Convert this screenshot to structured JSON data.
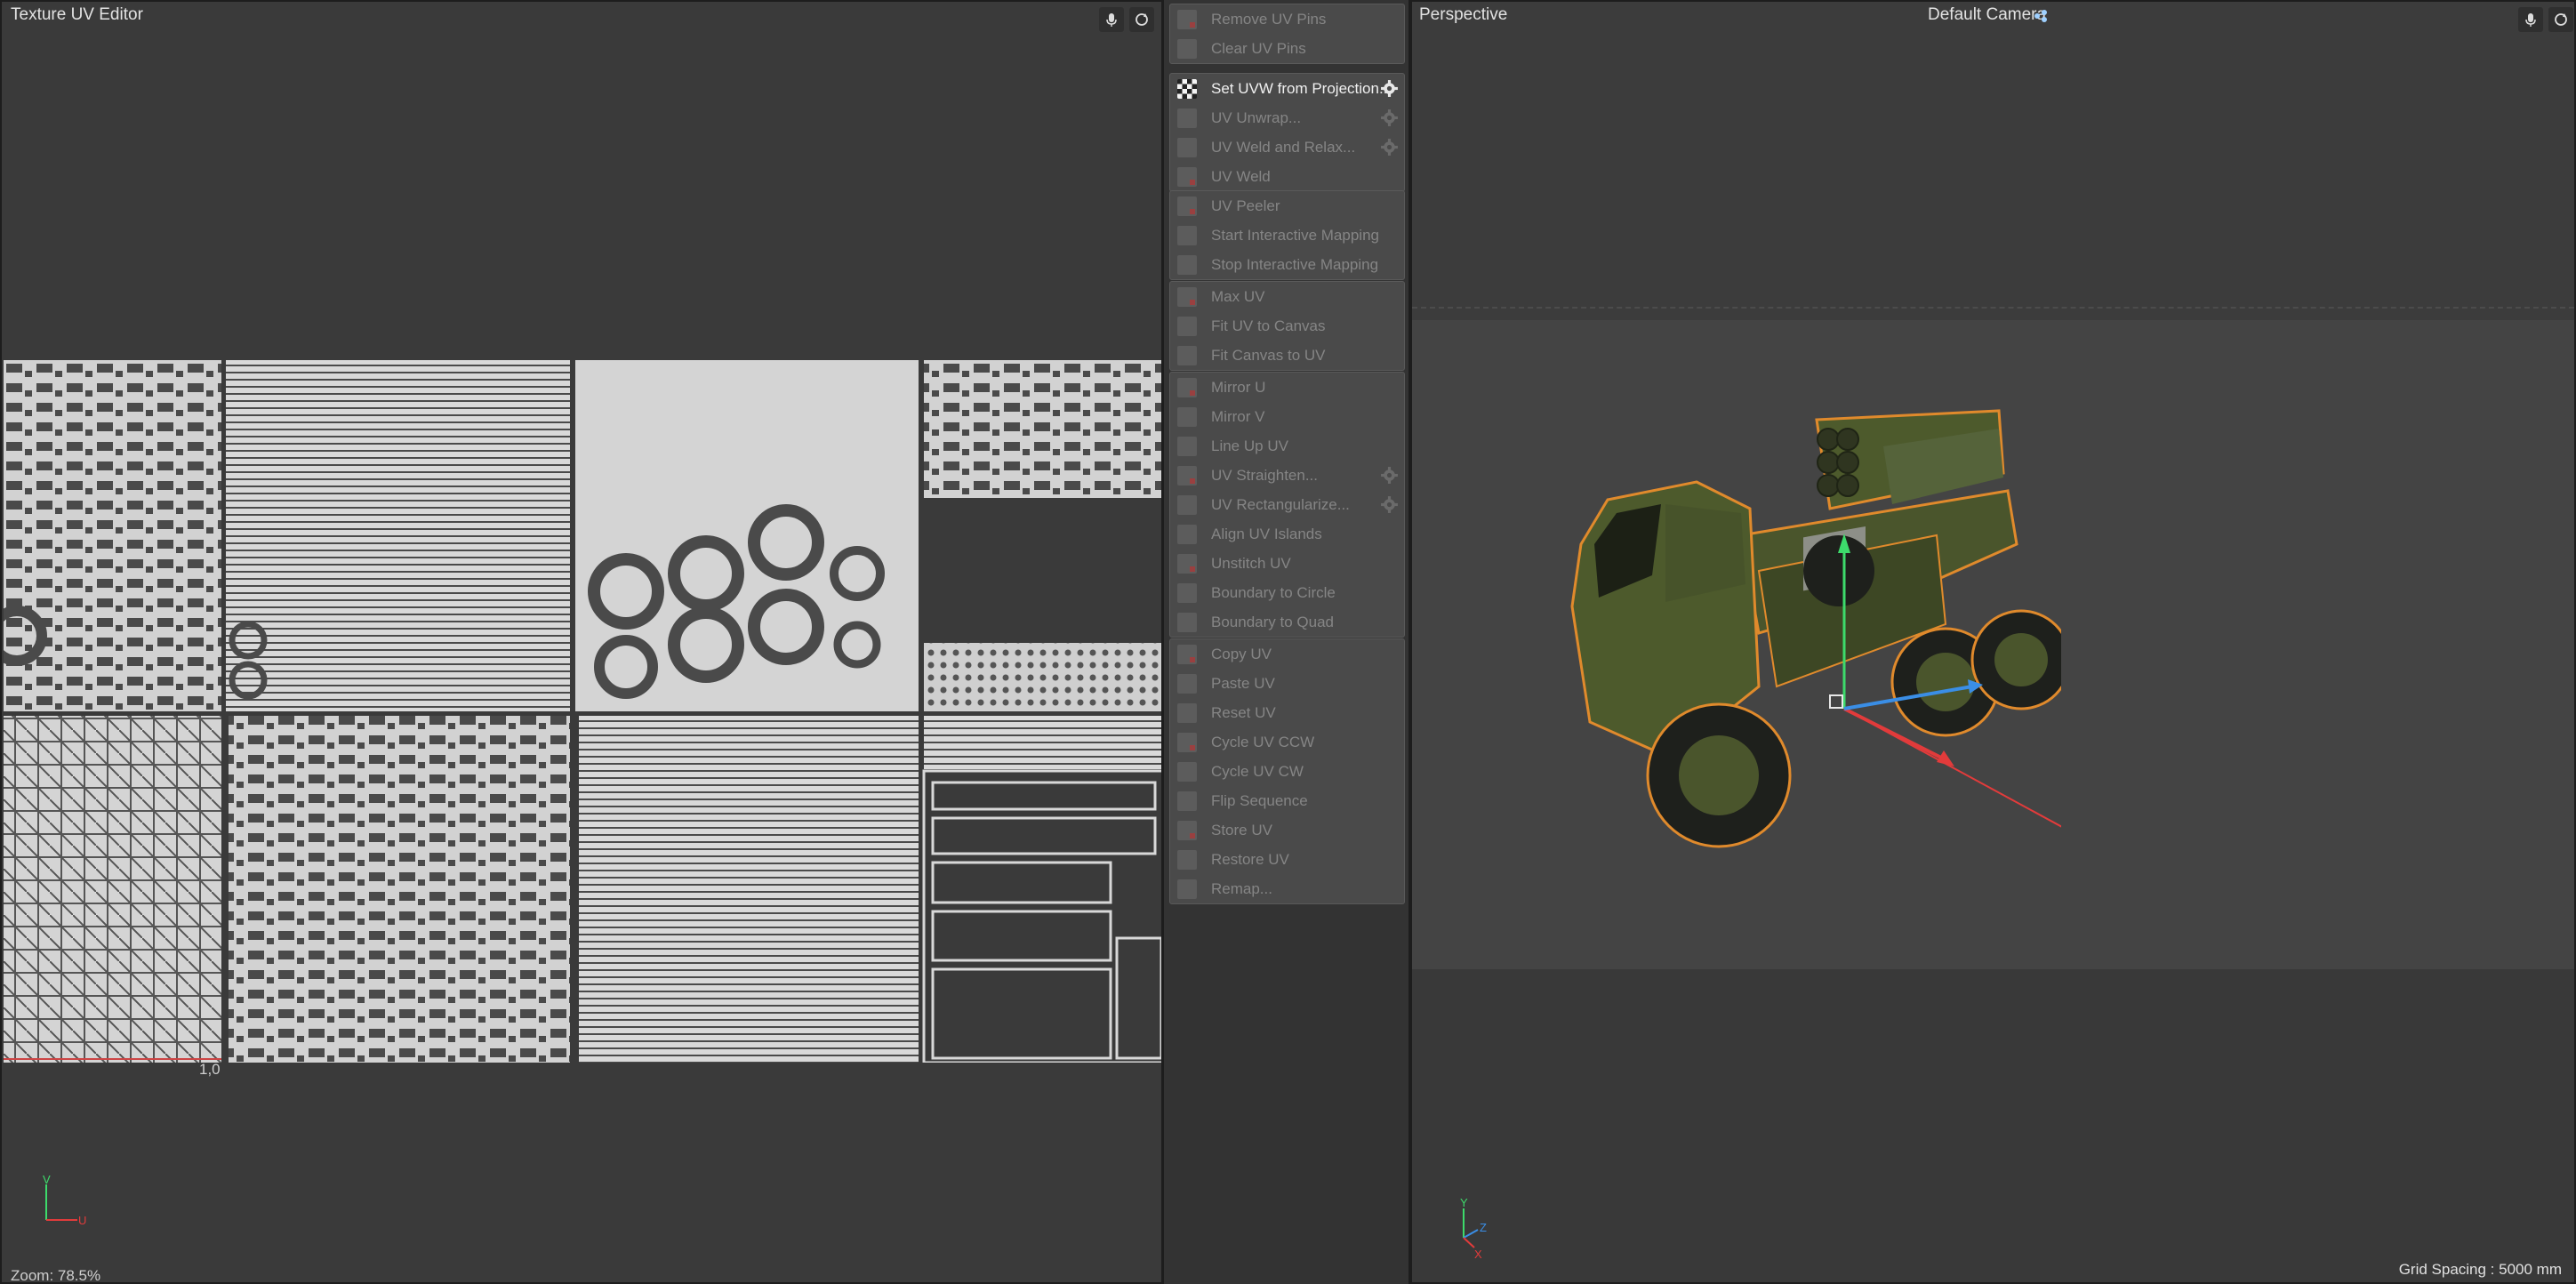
{
  "uv_editor": {
    "title": "Texture UV Editor",
    "origin_label": "1,0",
    "axis_v": "V",
    "axis_u": "U",
    "zoom": "Zoom: 78.5%"
  },
  "menu": {
    "groups": [
      {
        "items": [
          {
            "label": "Remove UV Pins",
            "enabled": false
          },
          {
            "label": "Clear UV Pins",
            "enabled": false
          }
        ]
      },
      {
        "items": [
          {
            "label": "Set UVW from Projection...",
            "enabled": true,
            "gear": true
          },
          {
            "label": "UV Unwrap...",
            "enabled": false,
            "gear": true
          },
          {
            "label": "UV Weld and Relax...",
            "enabled": false,
            "gear": true
          },
          {
            "label": "UV Weld",
            "enabled": false
          }
        ]
      },
      {
        "items": [
          {
            "label": "UV Peeler",
            "enabled": false
          },
          {
            "label": "Start Interactive Mapping",
            "enabled": false
          },
          {
            "label": "Stop Interactive Mapping",
            "enabled": false
          }
        ]
      },
      {
        "items": [
          {
            "label": "Max UV",
            "enabled": false
          },
          {
            "label": "Fit UV to Canvas",
            "enabled": false
          },
          {
            "label": "Fit Canvas to UV",
            "enabled": false
          }
        ]
      },
      {
        "items": [
          {
            "label": "Mirror U",
            "enabled": false
          },
          {
            "label": "Mirror V",
            "enabled": false
          },
          {
            "label": "Line Up UV",
            "enabled": false
          },
          {
            "label": "UV Straighten...",
            "enabled": false,
            "gear": true
          },
          {
            "label": "UV Rectangularize...",
            "enabled": false,
            "gear": true
          },
          {
            "label": "Align UV Islands",
            "enabled": false
          },
          {
            "label": "Unstitch UV",
            "enabled": false
          },
          {
            "label": "Boundary to Circle",
            "enabled": false
          },
          {
            "label": "Boundary to Quad",
            "enabled": false
          }
        ]
      },
      {
        "items": [
          {
            "label": "Copy UV",
            "enabled": false
          },
          {
            "label": "Paste UV",
            "enabled": false
          },
          {
            "label": "Reset UV",
            "enabled": false
          },
          {
            "label": "Cycle UV CCW",
            "enabled": false
          },
          {
            "label": "Cycle UV CW",
            "enabled": false
          },
          {
            "label": "Flip Sequence",
            "enabled": false
          },
          {
            "label": "Store UV",
            "enabled": false
          },
          {
            "label": "Restore UV",
            "enabled": false
          },
          {
            "label": "Remap...",
            "enabled": false
          }
        ]
      }
    ]
  },
  "viewport": {
    "title": "Perspective",
    "camera": "Default Camera",
    "axis_y": "Y",
    "axis_z": "Z",
    "axis_x": "X",
    "grid_spacing": "Grid Spacing : 5000 mm"
  },
  "colors": {
    "selection_outline": "#e08a2c",
    "truck_body": "#4d5a2c",
    "axis_x": "#e23b3b",
    "axis_y": "#3ddb6b",
    "axis_z": "#3a8ee6"
  }
}
